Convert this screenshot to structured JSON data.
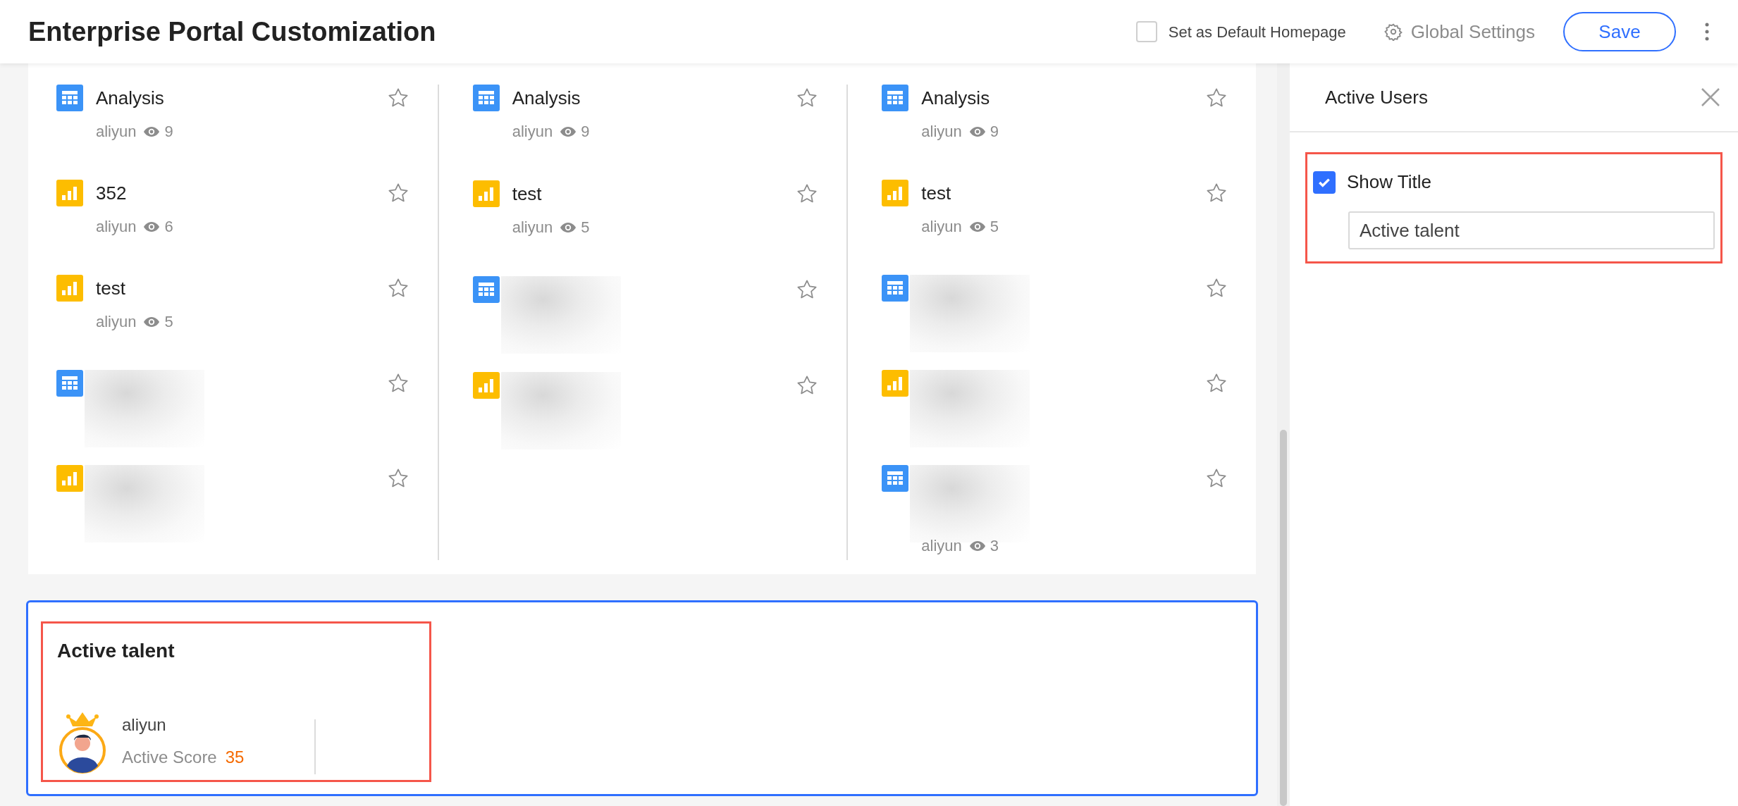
{
  "header": {
    "title": "Enterprise Portal Customization",
    "default_homepage": {
      "label": "Set as Default Homepage",
      "checked": false
    },
    "global_settings": "Global Settings",
    "save": "Save"
  },
  "columns": [
    {
      "items": [
        {
          "kind": "table",
          "blurred": false,
          "title": "Analysis",
          "owner": "aliyun",
          "views": "9"
        },
        {
          "kind": "chart",
          "blurred": false,
          "title": "352",
          "owner": "aliyun",
          "views": "6"
        },
        {
          "kind": "chart",
          "blurred": false,
          "title": "test",
          "owner": "aliyun",
          "views": "5"
        },
        {
          "kind": "table",
          "blurred": true
        },
        {
          "kind": "chart",
          "blurred": true
        }
      ]
    },
    {
      "items": [
        {
          "kind": "table",
          "blurred": false,
          "title": "Analysis",
          "owner": "aliyun",
          "views": "9"
        },
        {
          "kind": "chart",
          "blurred": false,
          "title": "test",
          "owner": "aliyun",
          "views": "5"
        },
        {
          "kind": "table",
          "blurred": true
        },
        {
          "kind": "chart",
          "blurred": true
        }
      ]
    },
    {
      "items": [
        {
          "kind": "table",
          "blurred": false,
          "title": "Analysis",
          "owner": "aliyun",
          "views": "9"
        },
        {
          "kind": "chart",
          "blurred": false,
          "title": "test",
          "owner": "aliyun",
          "views": "5"
        },
        {
          "kind": "table",
          "blurred": true
        },
        {
          "kind": "chart",
          "blurred": true
        },
        {
          "kind": "table",
          "blurred": true,
          "owner": "aliyun",
          "views": "3"
        }
      ]
    }
  ],
  "talent_card": {
    "title": "Active talent",
    "user": {
      "name": "aliyun",
      "score_label": "Active Score",
      "score": "35"
    }
  },
  "panel": {
    "title": "Active Users",
    "show_title": {
      "label": "Show Title",
      "checked": true
    },
    "title_value": "Active talent"
  }
}
